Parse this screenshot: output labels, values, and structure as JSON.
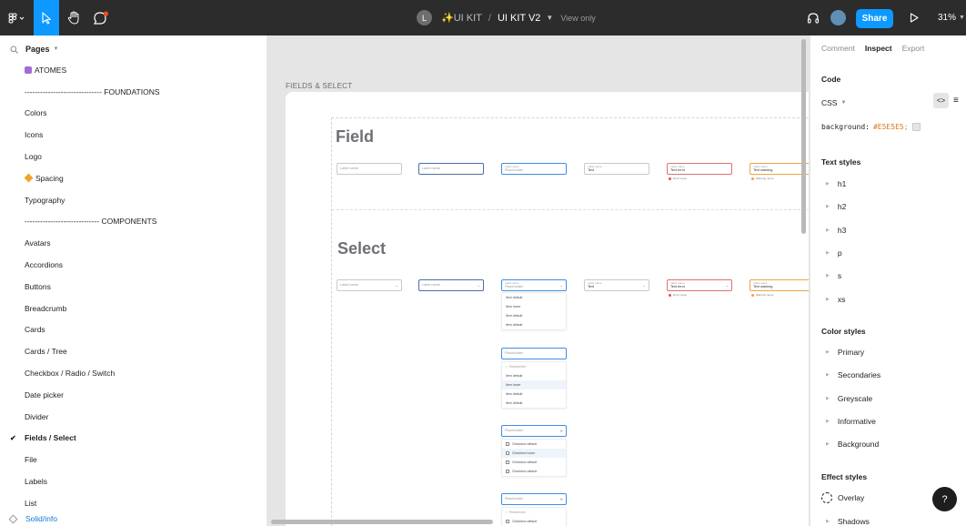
{
  "toolbar": {
    "project_name": "✨UI KIT",
    "separator": "/",
    "file_name": "UI KIT V2",
    "view_only": "View only",
    "avatar_initial": "L",
    "share_label": "Share",
    "zoom": "31%",
    "active_tool": "move",
    "accent": "#0d99ff"
  },
  "left_panel": {
    "pages_label": "Pages",
    "pages": [
      {
        "label": "ATOMES",
        "icon": "purple-square"
      },
      {
        "label": "------------------------------ FOUNDATIONS"
      },
      {
        "label": "Colors"
      },
      {
        "label": "Icons"
      },
      {
        "label": "Logo"
      },
      {
        "label": "Spacing",
        "icon": "orange-diamond"
      },
      {
        "label": "Typography"
      },
      {
        "label": "----------------------------- COMPONENTS"
      },
      {
        "label": "Avatars"
      },
      {
        "label": "Accordions"
      },
      {
        "label": "Buttons"
      },
      {
        "label": "Breadcrumb"
      },
      {
        "label": "Cards"
      },
      {
        "label": "Cards / Tree"
      },
      {
        "label": "Checkbox / Radio / Switch"
      },
      {
        "label": "Date picker"
      },
      {
        "label": "Divider"
      },
      {
        "label": "Fields / Select",
        "selected": true
      },
      {
        "label": "File"
      },
      {
        "label": "Labels"
      },
      {
        "label": "List"
      }
    ],
    "footer_layer": "Solid/info"
  },
  "canvas": {
    "frame_label": "FIELDS & SELECT",
    "field_title": "Field",
    "select_title": "Select",
    "field_row": [
      {
        "label": "",
        "value": "Label name",
        "state": "default"
      },
      {
        "label": "",
        "value": "Label name",
        "state": "hover"
      },
      {
        "label": "Label name",
        "value": "Placeholder",
        "state": "focus"
      },
      {
        "label": "Label name",
        "value": "Text",
        "state": "filled"
      },
      {
        "label": "Label name",
        "value": "Text error",
        "state": "error",
        "helper": "Error name"
      },
      {
        "label": "Label name",
        "value": "Text warning",
        "state": "warn",
        "helper": "Warning name"
      }
    ],
    "select_row": [
      {
        "label": "",
        "value": "Label name",
        "state": "default"
      },
      {
        "label": "",
        "value": "Label name",
        "state": "hover"
      },
      {
        "label": "Label name",
        "value": "Placeholder",
        "state": "focus"
      },
      {
        "label": "Label name",
        "value": "Text",
        "state": "filled"
      },
      {
        "label": "Label name",
        "value": "Text error",
        "state": "error",
        "helper": "Error name"
      },
      {
        "label": "Label name",
        "value": "Text warning",
        "state": "warn",
        "helper": "Warning name"
      }
    ],
    "dropdown1": [
      "Item default",
      "Item hover",
      "Item default",
      "Item default"
    ],
    "dropdown2": {
      "field": "Placeholder",
      "search": "Rechercher",
      "items": [
        "Item default",
        "Item hover",
        "Item default",
        "Item default"
      ]
    },
    "dropdown3": {
      "field": "Placeholder",
      "items": [
        "Checkbox default",
        "Checkbox hover",
        "Checkbox default",
        "Checkbox default"
      ]
    },
    "dropdown4": {
      "field": "Placeholder",
      "search": "Rechercher",
      "items": [
        "Checkbox default"
      ]
    }
  },
  "right_panel": {
    "tabs": [
      "Comment",
      "Inspect",
      "Export"
    ],
    "active_tab": "Inspect",
    "code_title": "Code",
    "language": "CSS",
    "code_property": "background:",
    "code_value": "#E5E5E5;",
    "text_styles_title": "Text styles",
    "text_styles": [
      "h1",
      "h2",
      "h3",
      "p",
      "s",
      "xs"
    ],
    "color_styles_title": "Color styles",
    "color_styles": [
      "Primary",
      "Secondaries",
      "Greyscale",
      "Informative",
      "Background"
    ],
    "effect_styles_title": "Effect styles",
    "effect_styles": [
      "Overlay",
      "Shadows"
    ],
    "help_label": "?"
  }
}
